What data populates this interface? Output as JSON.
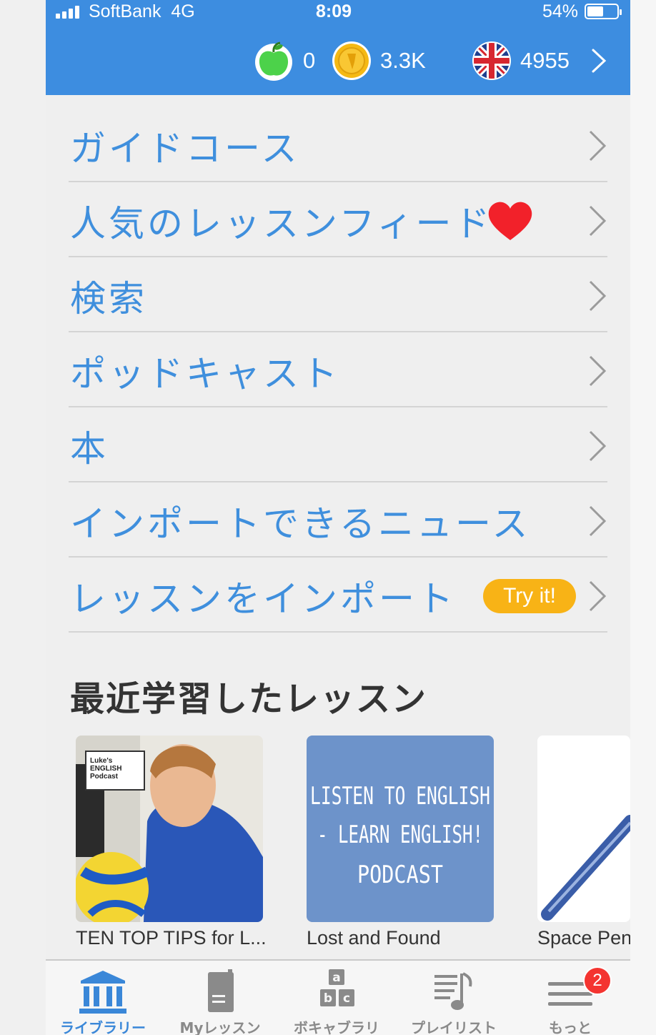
{
  "status_bar": {
    "carrier": "SoftBank",
    "network": "4G",
    "time": "8:09",
    "battery": "54%",
    "battery_level": 0.54
  },
  "header": {
    "apples": "0",
    "coins": "3.3K",
    "language_points": "4955",
    "language": "English (UK)"
  },
  "menu": [
    {
      "label": "ガイドコース"
    },
    {
      "label": "人気のレッスンフィード",
      "icon": "heart-icon"
    },
    {
      "label": "検索"
    },
    {
      "label": "ポッドキャスト"
    },
    {
      "label": "本"
    },
    {
      "label": "インポートできるニュース"
    },
    {
      "label": "レッスンをインポート",
      "pill": "Try it!"
    }
  ],
  "recent": {
    "title": "最近学習したレッスン",
    "lessons": [
      {
        "title": "TEN TOP TIPS for L...",
        "thumb_text": "Luke's ENGLISH Podcast"
      },
      {
        "title": "Lost and Found",
        "thumb_text": "LISTEN TO ENGLISH - LEARN ENGLISH! PODCAST"
      },
      {
        "title": "Space Pens"
      }
    ]
  },
  "tabs": [
    {
      "label": "ライブラリー",
      "icon": "library-icon",
      "active": true
    },
    {
      "label": "Myレッスン",
      "icon": "book-icon"
    },
    {
      "label": "ボキャブラリ",
      "icon": "vocabulary-icon"
    },
    {
      "label": "プレイリスト",
      "icon": "playlist-icon"
    },
    {
      "label": "もっと",
      "icon": "menu-icon",
      "badge": "2"
    }
  ],
  "colors": {
    "header_bg": "#3d8de0",
    "link": "#3f8fdd",
    "pill": "#f8b316",
    "badge": "#f43430"
  }
}
